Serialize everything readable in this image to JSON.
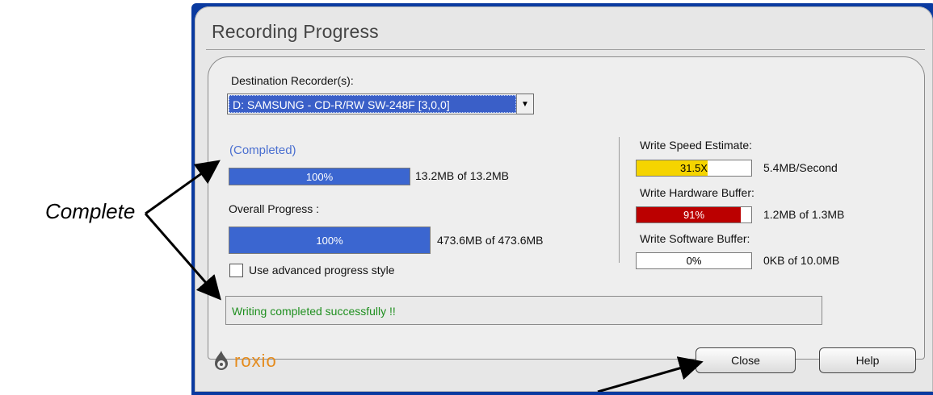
{
  "window": {
    "title": "Recording Progress"
  },
  "destination": {
    "label": "Destination Recorder(s):",
    "selected": "D: SAMSUNG - CD-R/RW SW-248F [3,0,0]"
  },
  "track": {
    "status": "(Completed)",
    "percent_text": "100%",
    "fraction": 1.0,
    "amount_text": "13.2MB of 13.2MB"
  },
  "overall": {
    "label": "Overall Progress :",
    "percent_text": "100%",
    "fraction": 1.0,
    "amount_text": "473.6MB of 473.6MB"
  },
  "advanced_option": {
    "label": "Use advanced progress style",
    "checked": false
  },
  "status_message": "Writing completed successfully !!",
  "speed": {
    "label": "Write Speed Estimate:",
    "value_text": "31.5X",
    "fraction": 0.62,
    "rate_text": "5.4MB/Second",
    "color": "#f5d400"
  },
  "hardware_buffer": {
    "label": "Write Hardware Buffer:",
    "value_text": "91%",
    "fraction": 0.91,
    "amount_text": "1.2MB of 1.3MB",
    "color": "#bb0000"
  },
  "software_buffer": {
    "label": "Write Software Buffer:",
    "value_text": "0%",
    "fraction": 0.0,
    "amount_text": "0KB of 10.0MB"
  },
  "buttons": {
    "close": "Close",
    "help": "Help"
  },
  "logo": {
    "text": "roxio"
  },
  "annotation": {
    "text": "Complete"
  },
  "colors": {
    "progress_blue": "#3b66d0",
    "status_green": "#1f8f1f",
    "window_blue": "#0a3aa0"
  }
}
